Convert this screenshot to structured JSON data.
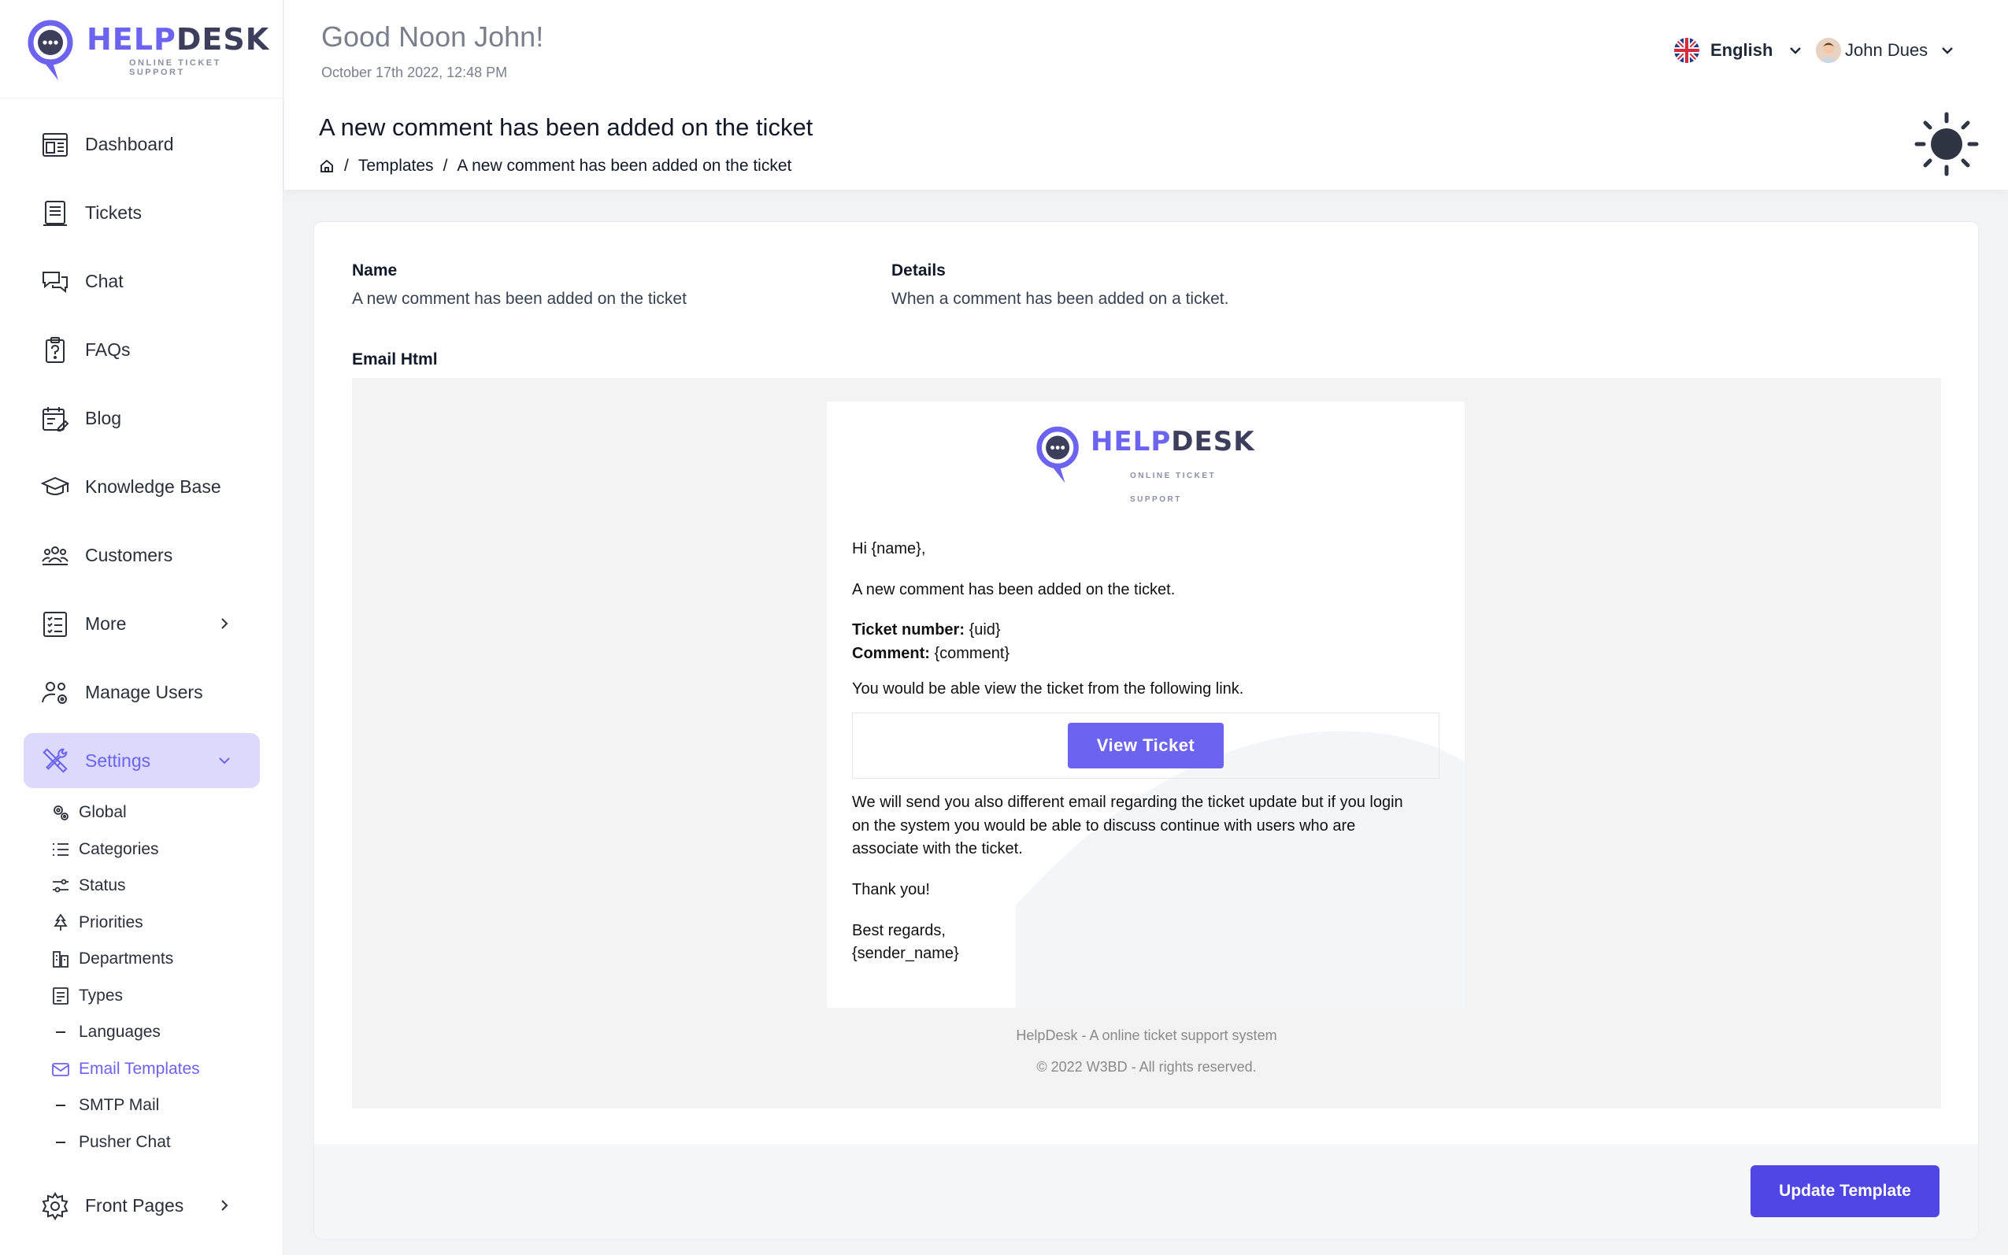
{
  "brand": {
    "name_part1": "HELP",
    "name_part2": "DESK",
    "tagline": "ONLINE TICKET SUPPORT",
    "accent": "#6c63f0"
  },
  "header": {
    "greeting": "Good Noon John!",
    "datetime": "October 17th 2022, 12:48 PM",
    "language": "English",
    "user_name": "John Dues"
  },
  "sidebar": {
    "items": [
      {
        "label": "Dashboard",
        "icon": "dashboard-icon"
      },
      {
        "label": "Tickets",
        "icon": "tickets-icon"
      },
      {
        "label": "Chat",
        "icon": "chat-icon"
      },
      {
        "label": "FAQs",
        "icon": "faq-icon"
      },
      {
        "label": "Blog",
        "icon": "blog-icon"
      },
      {
        "label": "Knowledge Base",
        "icon": "graduation-cap-icon"
      },
      {
        "label": "Customers",
        "icon": "customers-icon"
      },
      {
        "label": "More",
        "icon": "list-icon"
      },
      {
        "label": "Manage Users",
        "icon": "manage-users-icon"
      },
      {
        "label": "Settings",
        "icon": "settings-tools-icon"
      }
    ],
    "settings_sub": [
      {
        "label": "Global",
        "icon": "gears-icon"
      },
      {
        "label": "Categories",
        "icon": "list-icon"
      },
      {
        "label": "Status",
        "icon": "sliders-icon"
      },
      {
        "label": "Priorities",
        "icon": "tree-icon"
      },
      {
        "label": "Departments",
        "icon": "building-icon"
      },
      {
        "label": "Types",
        "icon": "checklist-icon"
      },
      {
        "label": "Languages",
        "icon": "dash-icon"
      },
      {
        "label": "Email Templates",
        "icon": "envelope-icon"
      },
      {
        "label": "SMTP Mail",
        "icon": "dash-icon"
      },
      {
        "label": "Pusher Chat",
        "icon": "dash-icon"
      }
    ],
    "front_pages": "Front Pages"
  },
  "page": {
    "title": "A new comment has been added on the ticket",
    "breadcrumb": [
      "Templates",
      "A new comment has been added on the ticket"
    ],
    "sep": "/"
  },
  "template": {
    "name_label": "Name",
    "name_value": "A new comment has been added on the ticket",
    "details_label": "Details",
    "details_value": "When a comment has been added on a ticket.",
    "html_label": "Email Html"
  },
  "email": {
    "greeting": "Hi {name},",
    "intro": "A new comment has been added on the ticket.",
    "ticket_label": "Ticket number:",
    "ticket_value": "{uid}",
    "comment_label": "Comment:",
    "comment_value": "{comment}",
    "link_text": "You would be able view the ticket from the following link.",
    "button": "View Ticket",
    "para_line1": "We will send you also different email regarding the ticket update but if you login",
    "para_line2": "on the system you would be able to discuss continue with users who are",
    "para_line3": "associate with the ticket.",
    "thanks": "Thank you!",
    "regards": "Best regards,",
    "sender": "{sender_name}",
    "footer1": "HelpDesk - A online ticket support system",
    "footer2": "© 2022 W3BD - All rights reserved."
  },
  "actions": {
    "update": "Update Template"
  }
}
